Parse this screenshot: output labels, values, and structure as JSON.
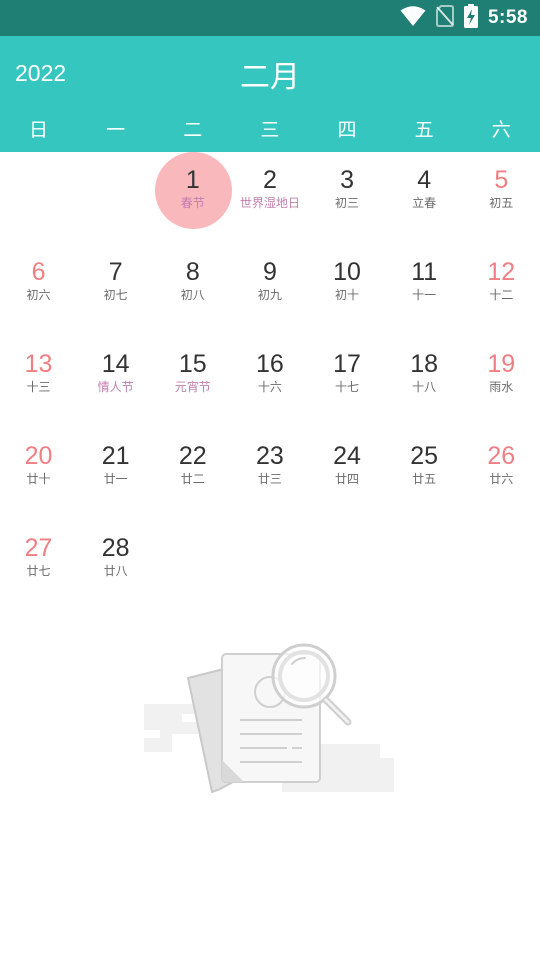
{
  "status_bar": {
    "time": "5:58",
    "icons": [
      "wifi-icon",
      "no-sim-icon",
      "battery-charging-icon"
    ]
  },
  "header": {
    "year": "2022",
    "month": "二月",
    "weekdays": [
      "日",
      "一",
      "二",
      "三",
      "四",
      "五",
      "六"
    ],
    "background_color": "#35c6bf"
  },
  "calendar": {
    "selected_day": "1",
    "weeks": [
      [
        {
          "day": "",
          "sub": ""
        },
        {
          "day": "",
          "sub": ""
        },
        {
          "day": "1",
          "sub": "春节",
          "festival": true,
          "selected": true
        },
        {
          "day": "2",
          "sub": "世界湿地日",
          "festival": true
        },
        {
          "day": "3",
          "sub": "初三"
        },
        {
          "day": "4",
          "sub": "立春"
        },
        {
          "day": "5",
          "sub": "初五",
          "weekend": true
        }
      ],
      [
        {
          "day": "6",
          "sub": "初六",
          "weekend": true
        },
        {
          "day": "7",
          "sub": "初七"
        },
        {
          "day": "8",
          "sub": "初八"
        },
        {
          "day": "9",
          "sub": "初九"
        },
        {
          "day": "10",
          "sub": "初十"
        },
        {
          "day": "11",
          "sub": "十一"
        },
        {
          "day": "12",
          "sub": "十二",
          "weekend": true
        }
      ],
      [
        {
          "day": "13",
          "sub": "十三",
          "weekend": true
        },
        {
          "day": "14",
          "sub": "情人节",
          "festival": true
        },
        {
          "day": "15",
          "sub": "元宵节",
          "festival": true
        },
        {
          "day": "16",
          "sub": "十六"
        },
        {
          "day": "17",
          "sub": "十七"
        },
        {
          "day": "18",
          "sub": "十八"
        },
        {
          "day": "19",
          "sub": "雨水",
          "weekend": true
        }
      ],
      [
        {
          "day": "20",
          "sub": "廿十",
          "weekend": true
        },
        {
          "day": "21",
          "sub": "廿一"
        },
        {
          "day": "22",
          "sub": "廿二"
        },
        {
          "day": "23",
          "sub": "廿三"
        },
        {
          "day": "24",
          "sub": "廿四"
        },
        {
          "day": "25",
          "sub": "廿五"
        },
        {
          "day": "26",
          "sub": "廿六",
          "weekend": true
        }
      ],
      [
        {
          "day": "27",
          "sub": "廿七",
          "weekend": true
        },
        {
          "day": "28",
          "sub": "廿八"
        },
        {
          "day": "",
          "sub": ""
        },
        {
          "day": "",
          "sub": ""
        },
        {
          "day": "",
          "sub": ""
        },
        {
          "day": "",
          "sub": ""
        },
        {
          "day": "",
          "sub": ""
        }
      ]
    ]
  },
  "empty_state": {
    "icon": "empty-document-search-icon"
  },
  "colors": {
    "status_bar": "#1f7f74",
    "accent": "#35c6bf",
    "weekend": "#f07f84",
    "festival": "#c07fb0",
    "selected": "#f9b8bb"
  }
}
